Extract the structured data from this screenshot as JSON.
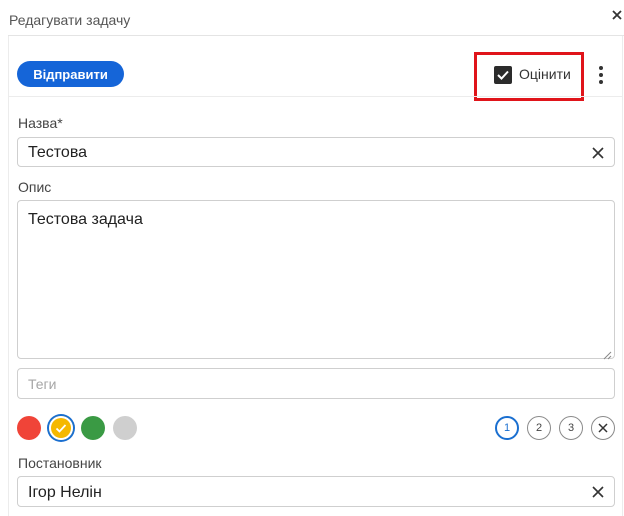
{
  "dialog": {
    "title": "Редагувати задачу"
  },
  "toolbar": {
    "submit_label": "Відправити",
    "rate_label": "Оцінити",
    "rate_checked": true
  },
  "form": {
    "name": {
      "label": "Назва*",
      "value": "Тестова"
    },
    "description": {
      "label": "Опис",
      "value": "Тестова задача"
    },
    "tags": {
      "placeholder": "Теги"
    },
    "colors": [
      {
        "name": "red",
        "hex": "#f04438",
        "selected": false
      },
      {
        "name": "yellow",
        "hex": "#f5b800",
        "selected": true
      },
      {
        "name": "green",
        "hex": "#3a9a44",
        "selected": false
      },
      {
        "name": "gray",
        "hex": "#cfcfcf",
        "selected": false
      }
    ],
    "priority": {
      "options": [
        "1",
        "2",
        "3"
      ],
      "selected": "1"
    },
    "assigner": {
      "label": "Постановник",
      "value": "Ігор Нелін"
    }
  }
}
